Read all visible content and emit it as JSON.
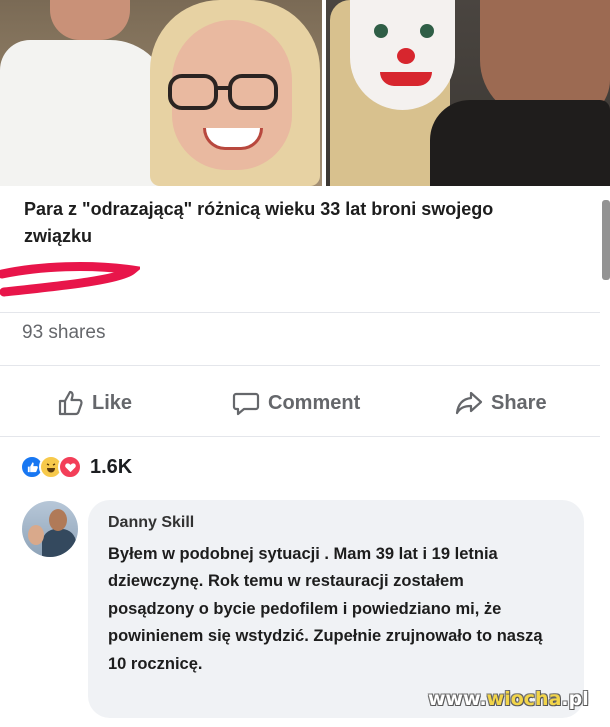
{
  "post": {
    "headline": "Para z \"odrazającą\" różnicą wieku 33 lat broni swojego związku",
    "shares": "93 shares"
  },
  "actions": {
    "like": "Like",
    "comment": "Comment",
    "share": "Share"
  },
  "reactions": {
    "icons": [
      "like-icon",
      "haha-icon",
      "love-icon"
    ],
    "count": "1.6K"
  },
  "comment": {
    "author": "Danny Skill",
    "text": "Byłem w podobnej sytuacji . Mam 39 lat i 19 letnia dziewczynę. Rok temu w restauracji zostałem posądzony o bycie pedofilem i powiedziano mi, że powinienem się wstydzić. Zupełnie zrujnowało to naszą 10 rocznicę."
  },
  "watermark": {
    "prefix": "www.",
    "brand": "wiocha",
    "suffix": ".pl"
  },
  "colors": {
    "facebook_blue": "#1877f2",
    "muted_text": "#65676b",
    "comment_bubble": "#f0f2f5",
    "highlight_red": "#e8154a"
  }
}
